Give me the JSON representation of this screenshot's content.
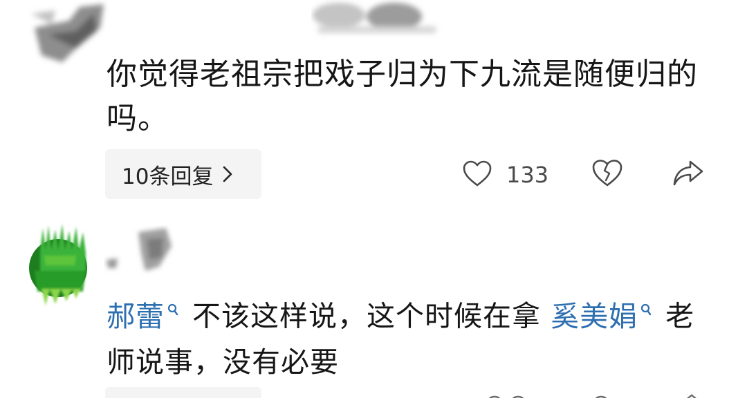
{
  "comments": [
    {
      "text": "你觉得老祖宗把戏子归为下九流是随便归的吗。",
      "reply_button_label": "10条回复",
      "like_count": "133"
    },
    {
      "mention1": "郝蕾",
      "text_part1": "不该这样说，这个时候在拿",
      "mention2": "奚美娟",
      "text_part2": "老师说事，没有必要"
    }
  ],
  "icons": {
    "like": "heart-outline-icon",
    "dislike": "broken-heart-icon",
    "share": "share-arrow-icon",
    "reply_chevron": "chevron-right-icon",
    "mention_search": "search-icon"
  },
  "colors": {
    "mention": "#2e6fb0",
    "pill_background": "#f4f4f4",
    "icon_gray": "#4a4a4a",
    "avatar_green": "#2a9a2a"
  }
}
